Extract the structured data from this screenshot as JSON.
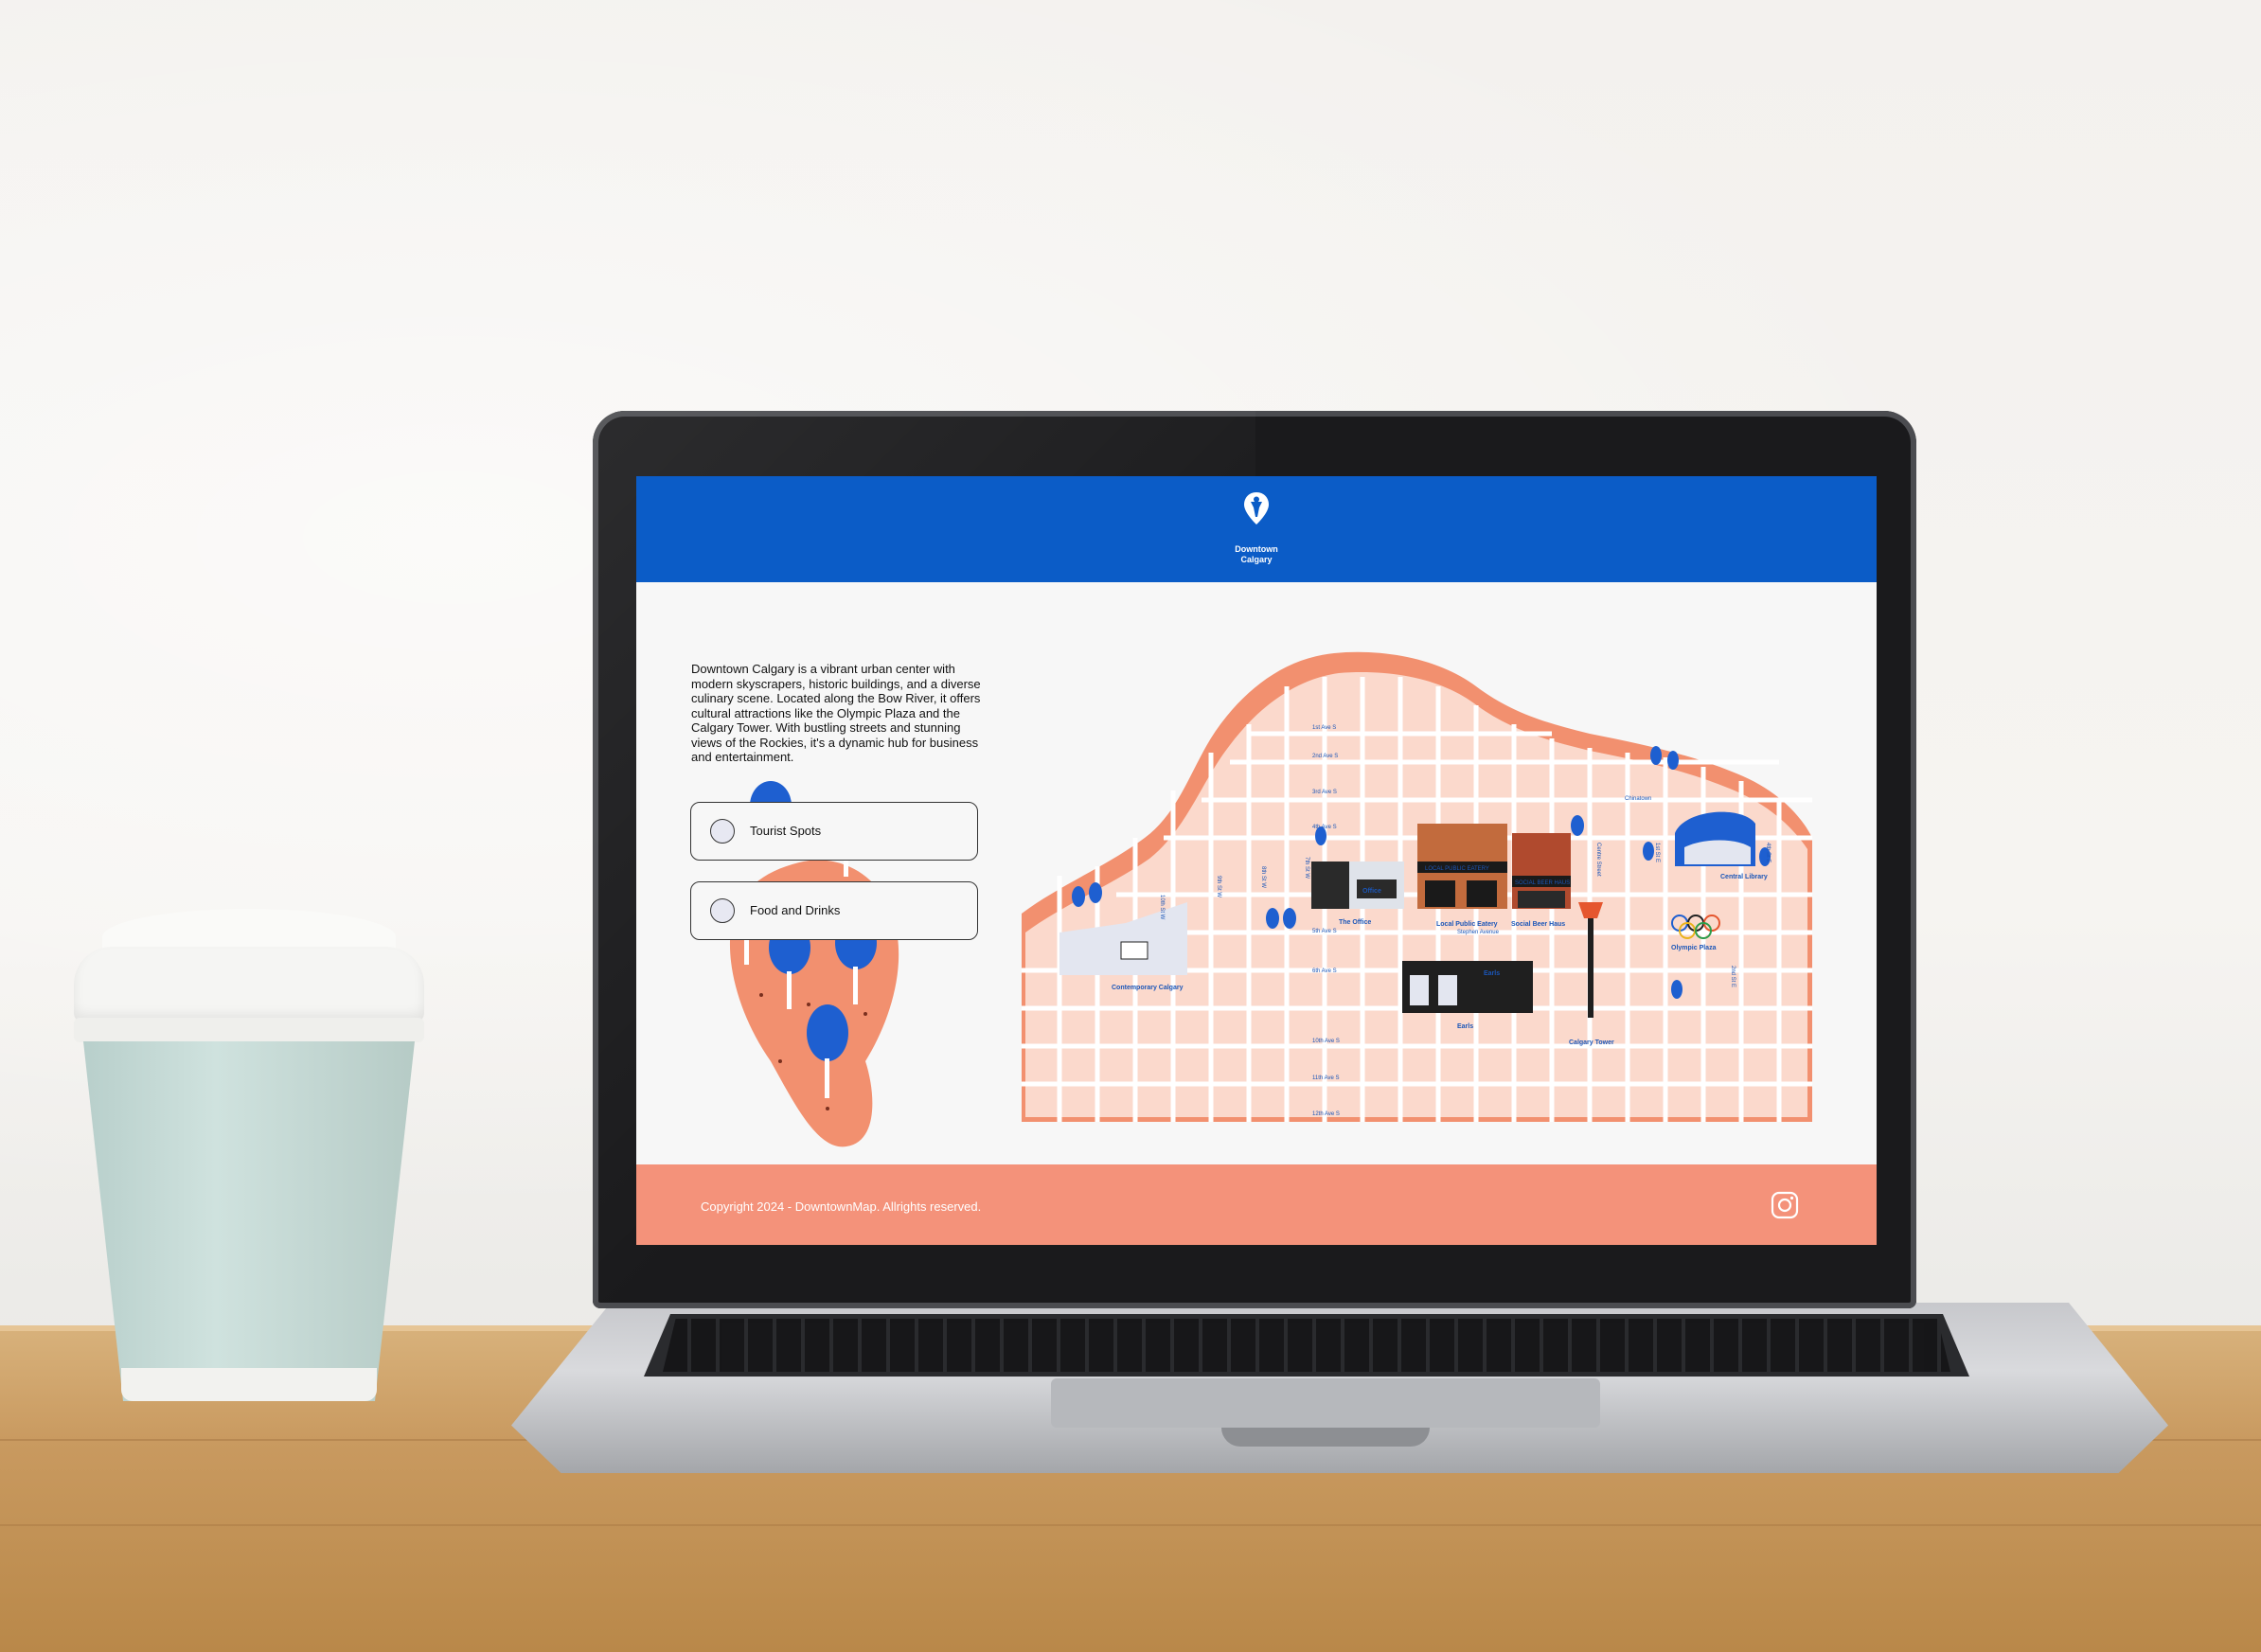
{
  "site": {
    "brand_line1": "Downtown",
    "brand_line2": "Calgary",
    "description": "Downtown Calgary is a vibrant urban center with modern skyscrapers, historic buildings, and a diverse culinary scene. Located along the Bow River, it offers cultural attractions like the Olympic Plaza and the Calgary Tower. With bustling streets and stunning views of the Rockies, it's a dynamic hub for business and entertainment.",
    "options": [
      {
        "label": "Tourist Spots"
      },
      {
        "label": "Food and Drinks"
      }
    ],
    "footer": {
      "copyright": "Copyright 2024 - DowntownMap. Allrights reserved.",
      "icon": "instagram-icon"
    }
  },
  "map": {
    "streets": {
      "avenues": [
        "1st Ave S",
        "2nd Ave S",
        "3rd Ave S",
        "4th Ave S",
        "5th Ave S",
        "6th Ave S",
        "9th Ave S",
        "10th Ave S",
        "11th Ave S",
        "12th Ave S"
      ],
      "streets": [
        "10th St W",
        "9th St W",
        "8th St W",
        "7th St W",
        "1st St E",
        "4th St E",
        "2nd St E",
        "Centre Street",
        "Stephen Avenue",
        "Chinatown"
      ]
    },
    "places": {
      "contemporary": "Contemporary Calgary",
      "office": "The Office",
      "local_public": "Local Public Eatery",
      "social_beer": "Social Beer Haus",
      "earls": "Earls",
      "tower": "Calgary Tower",
      "library": "Central Library",
      "olympic": "Olympic Plaza"
    },
    "signs": {
      "local_public": "LOCAL PUBLIC EATERY",
      "social_beer": "SOCIAL BEER HAUS",
      "office": "Office",
      "earls": "Earls"
    }
  },
  "colors": {
    "header_blue": "#0b5cc7",
    "footer_salmon": "#f4927a",
    "map_orange": "#f2906f",
    "map_pale": "#fbd9cc",
    "tree_blue": "#1e5fd0"
  }
}
